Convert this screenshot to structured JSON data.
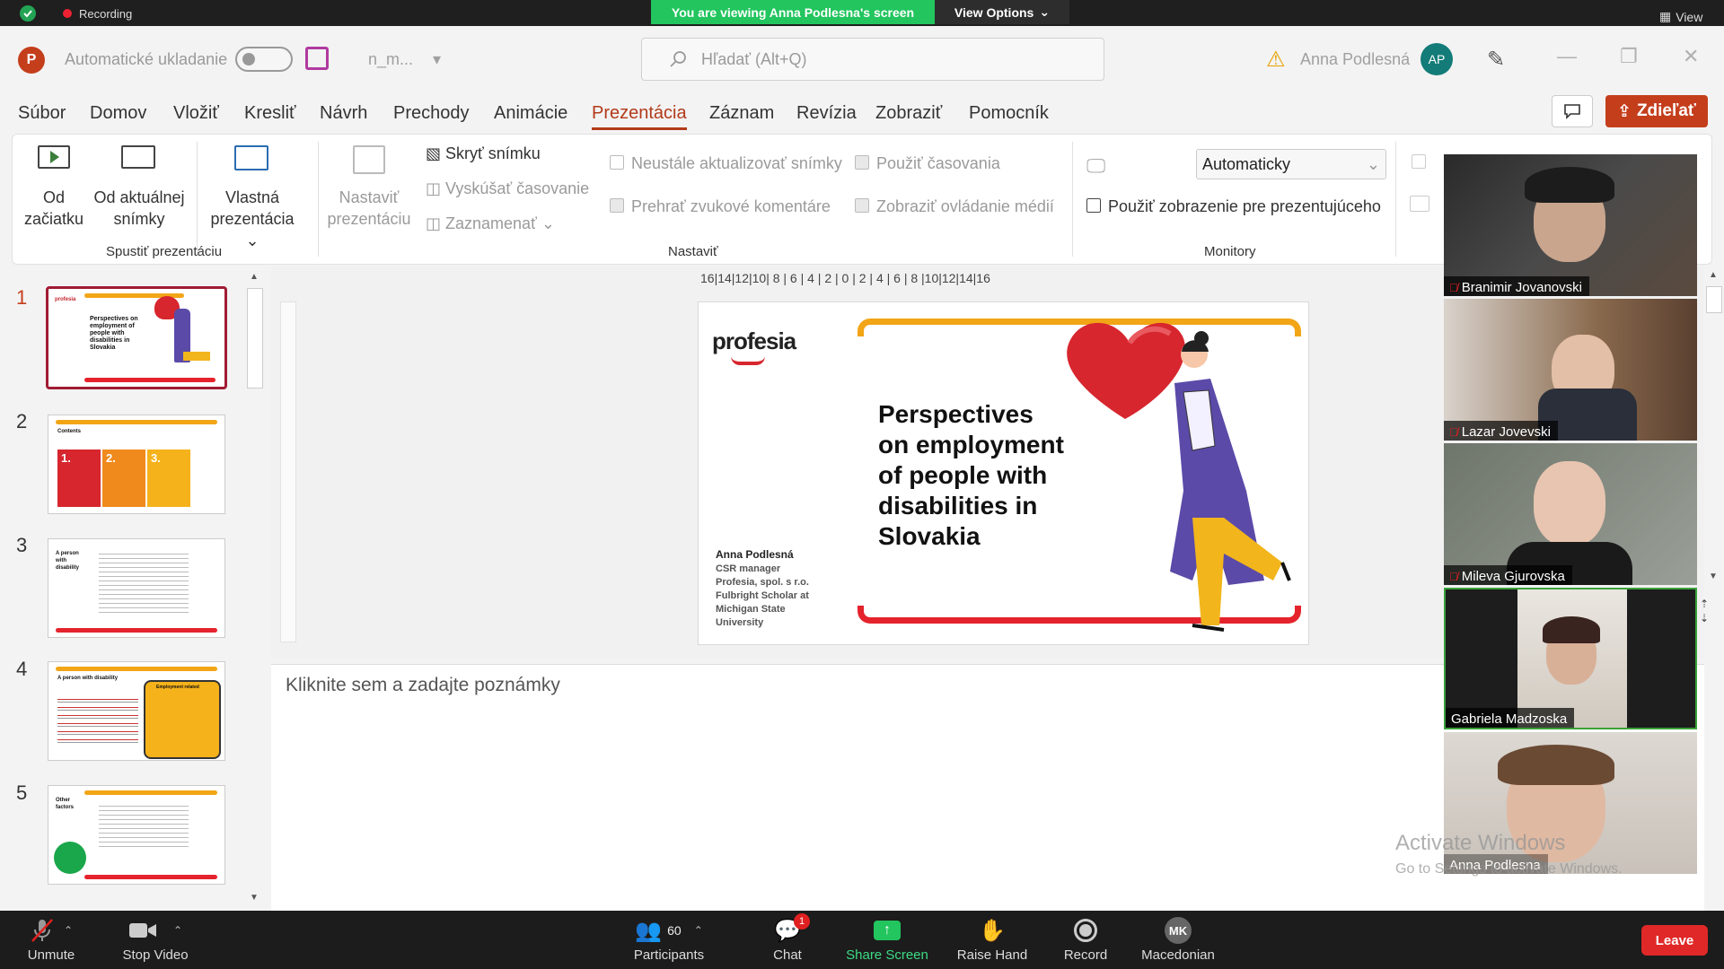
{
  "zoom": {
    "recording_label": "Recording",
    "viewing_banner": "You are viewing Anna Podlesna's screen",
    "view_options": "View Options",
    "view_label": "View",
    "participants_count": "60",
    "chat_badge": "1",
    "bottom": {
      "unmute": "Unmute",
      "stop_video": "Stop Video",
      "participants": "Participants",
      "chat": "Chat",
      "share_screen": "Share Screen",
      "raise_hand": "Raise Hand",
      "record": "Record",
      "language": "Macedonian",
      "language_initials": "MK",
      "leave": "Leave"
    },
    "gallery": [
      {
        "name": "Branimir Jovanovski",
        "muted": true
      },
      {
        "name": "Lazar Jovevski",
        "muted": true
      },
      {
        "name": "Mileva Gjurovska",
        "muted": true
      },
      {
        "name": "Gabriela Madzoska",
        "muted": false
      },
      {
        "name": "Anna Podlesna",
        "muted": false
      }
    ],
    "activate_windows": "Activate Windows",
    "activate_windows_sub": "Go to Settings to activate Windows."
  },
  "ppt": {
    "logo_letter": "P",
    "autosave": "Automatické ukladanie",
    "filename": "n_m...",
    "search_placeholder": "Hľadať (Alt+Q)",
    "user_name": "Anna Podlesná",
    "user_initials": "AP",
    "share_button": "Zdieľať",
    "menu": [
      "Súbor",
      "Domov",
      "Vložiť",
      "Kresliť",
      "Návrh",
      "Prechody",
      "Animácie",
      "Prezentácia",
      "Záznam",
      "Revízia",
      "Zobraziť",
      "Pomocník"
    ],
    "active_menu_index": 7,
    "ribbon": {
      "od_zaciatku": [
        "Od",
        "začiatku"
      ],
      "od_aktualnej": [
        "Od aktuálnej",
        "snímky"
      ],
      "vlastna": [
        "Vlastná",
        "prezentácia ⌄"
      ],
      "group_spustit": "Spustiť prezentáciu",
      "nastavit": [
        "Nastaviť",
        "prezentáciu"
      ],
      "skryt": "Skryť snímku",
      "vyskusat": "Vyskúšať časovanie",
      "zaznamenat": "Zaznamenať",
      "neustale": "Neustále aktualizovať snímky",
      "prehrat": "Prehrať zvukové komentáre",
      "pouzit_casovania": "Použiť časovania",
      "zobrazit_ovladanie": "Zobraziť ovládanie médií",
      "group_nastavit": "Nastaviť",
      "monitor_select": "Automaticky",
      "pouzit_zobrazenie": "Použiť zobrazenie pre prezentujúceho",
      "group_monitory": "Monitory"
    },
    "ruler": "16|14|12|10| 8 | 6 | 4 | 2 | 0 | 2 | 4 | 6 | 8 |10|12|14|16",
    "notes_placeholder": "Kliknite sem a zadajte poznámky",
    "thumbnails": [
      {
        "num": "1",
        "title": "Perspectives on employment of people with disabilities in Slovakia"
      },
      {
        "num": "2",
        "title": "Contents",
        "boxes": [
          "1.",
          "2.",
          "3."
        ]
      },
      {
        "num": "3",
        "title": "A person with disability"
      },
      {
        "num": "4",
        "title": "A person with disability",
        "side": "Employment related"
      },
      {
        "num": "5",
        "title": "Other factors"
      }
    ]
  },
  "slide": {
    "logo": "profesia",
    "title_lines": [
      "Perspectives",
      "on employment",
      "of people with",
      "disabilities in",
      "Slovakia"
    ],
    "author": "Anna Podlesná",
    "author_lines": [
      "CSR manager",
      "Profesia, spol. s r.o.",
      "Fulbright Scholar at",
      "Michigan State",
      "University"
    ]
  }
}
